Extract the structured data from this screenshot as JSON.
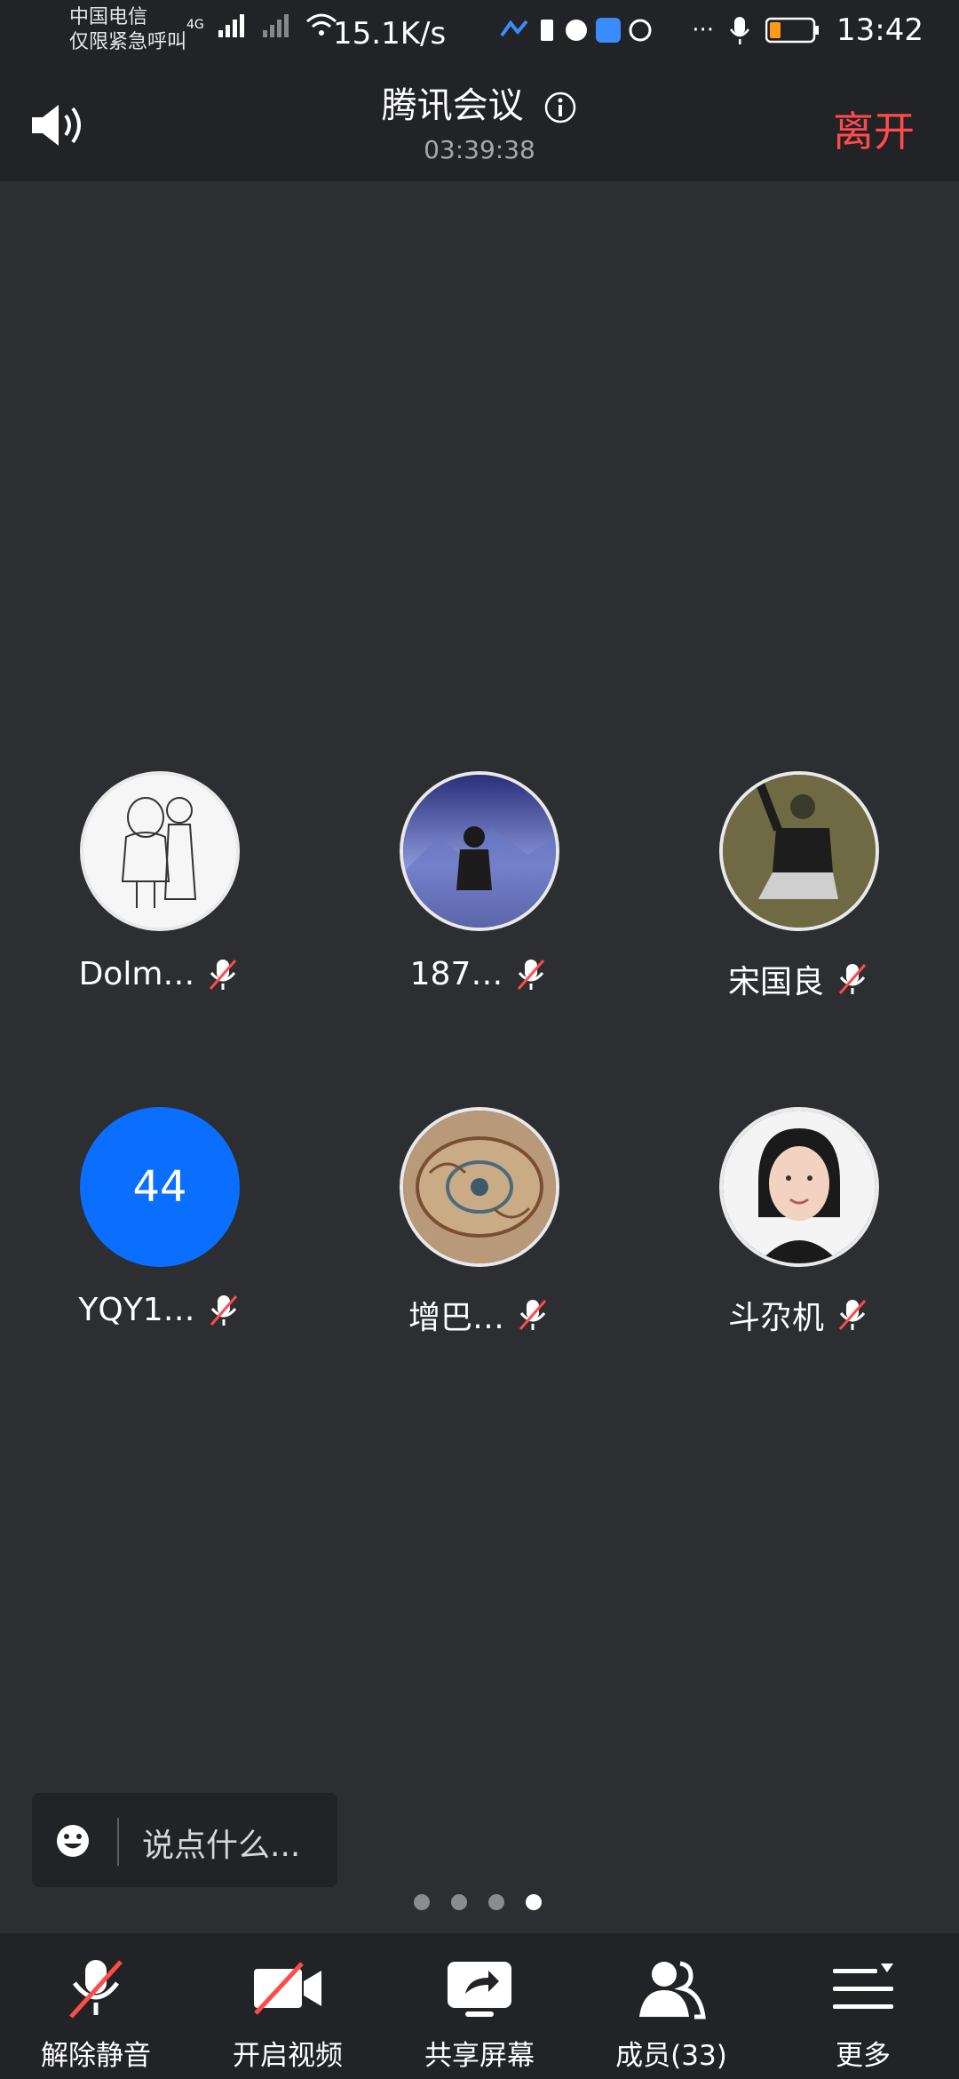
{
  "status": {
    "carrier_line1": "中国电信",
    "carrier_line2": "仅限紧急呼叫",
    "net_type": "4G",
    "speed": "15.1K/s",
    "more": "···",
    "time": "13:42"
  },
  "header": {
    "title": "腾讯会议",
    "duration": "03:39:38",
    "leave_label": "离开"
  },
  "participants": [
    {
      "name": "Dolm…"
    },
    {
      "name": "187…"
    },
    {
      "name": "宋国良"
    },
    {
      "name": "YQY1…",
      "avatar_text": "44"
    },
    {
      "name": "增巴…"
    },
    {
      "name": "斗尕机"
    }
  ],
  "chat": {
    "placeholder": "说点什么..."
  },
  "pager": {
    "count": 4,
    "active_index": 3
  },
  "toolbar": {
    "unmute_label": "解除静音",
    "video_label": "开启视频",
    "share_label": "共享屏幕",
    "members_label": "成员(33)",
    "more_label": "更多"
  },
  "colors": {
    "background": "#2c2e32",
    "bar": "#222326",
    "leave": "#ff4b4b",
    "accent_blue": "#0a6fff",
    "mute_red": "#ff4b4b"
  }
}
